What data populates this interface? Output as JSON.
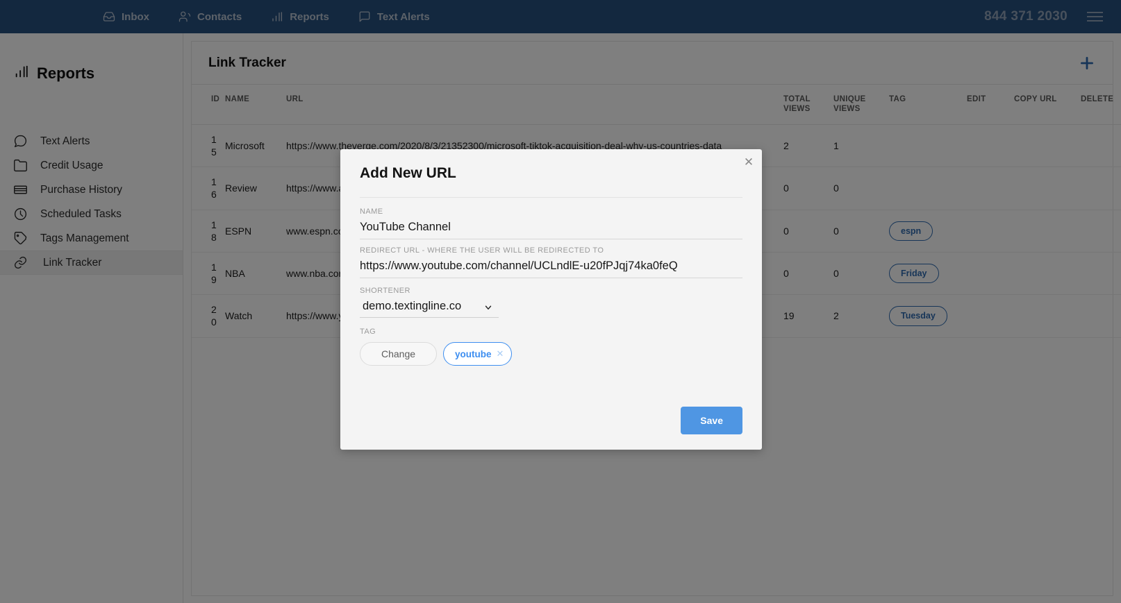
{
  "topnav": {
    "links": [
      {
        "label": "Inbox",
        "icon": "inbox-icon"
      },
      {
        "label": "Contacts",
        "icon": "contacts-icon"
      },
      {
        "label": "Reports",
        "icon": "bar-chart-icon"
      },
      {
        "label": "Text Alerts",
        "icon": "chat-bubble-icon"
      }
    ],
    "phone": "844 371 2030",
    "menu_icon": "hamburger-icon"
  },
  "sidebar": {
    "title": "Reports",
    "title_icon": "bar-chart-icon",
    "items": [
      {
        "label": "Text Alerts",
        "icon": "chat-bubble-icon",
        "active": false
      },
      {
        "label": "Credit Usage",
        "icon": "folder-icon",
        "active": false
      },
      {
        "label": "Purchase History",
        "icon": "card-icon",
        "active": false
      },
      {
        "label": "Scheduled Tasks",
        "icon": "clock-icon",
        "active": false
      },
      {
        "label": "Tags Management",
        "icon": "tag-icon",
        "active": false
      },
      {
        "label": "Link Tracker",
        "icon": "link-icon",
        "active": true
      }
    ]
  },
  "main": {
    "page_title": "Link Tracker",
    "add_button_icon": "plus-icon",
    "table": {
      "columns": [
        "ID",
        "NAME",
        "URL",
        "TOTAL VIEWS",
        "UNIQUE VIEWS",
        "TAG",
        "EDIT",
        "COPY URL",
        "DELETE"
      ],
      "rows": [
        {
          "id": "15",
          "name": "Microsoft",
          "url": "https://www.theverge.com/2020/8/3/21352300/microsoft-tiktok-acquisition-deal-why-us-countries-data",
          "total_views": "2",
          "unique_views": "1",
          "tag": ""
        },
        {
          "id": "16",
          "name": "Review",
          "url": "https://www.amazon.com/review-price/dsalkjfsdfsdfsdfsdfsdfsdfsdfsdfsdfsdf",
          "total_views": "0",
          "unique_views": "0",
          "tag": ""
        },
        {
          "id": "18",
          "name": "ESPN",
          "url": "www.espn.com",
          "total_views": "0",
          "unique_views": "0",
          "tag": "espn"
        },
        {
          "id": "19",
          "name": "NBA",
          "url": "www.nba.com",
          "total_views": "0",
          "unique_views": "0",
          "tag": "Friday"
        },
        {
          "id": "20",
          "name": "Watch",
          "url": "https://www.youtube.com/watch",
          "total_views": "19",
          "unique_views": "2",
          "tag": "Tuesday"
        }
      ]
    }
  },
  "modal": {
    "title": "Add New URL",
    "close_icon": "close-icon",
    "name_label": "NAME",
    "name_value": "YouTube Channel",
    "name_placeholder": "",
    "redirect_label": "REDIRECT URL - WHERE THE USER WILL BE REDIRECTED TO",
    "redirect_value": "https://www.youtube.com/channel/UCLndlE-u20fPJqj74ka0feQ",
    "redirect_placeholder": "",
    "shortener_label": "SHORTENER",
    "shortener_value": "demo.textingline.co",
    "shortener_options": [
      "demo.textingline.co"
    ],
    "tag_label": "TAG",
    "tag_change_label": "Change",
    "tag_chip_label": "youtube",
    "tag_chip_remove_icon": "close-icon",
    "save_label": "Save"
  },
  "colors": {
    "nav_blue": "#27507f",
    "accent_blue": "#4f96e3",
    "tag_blue": "#2f6bb0",
    "overlay": "rgba(0,0,0,0.5)"
  }
}
